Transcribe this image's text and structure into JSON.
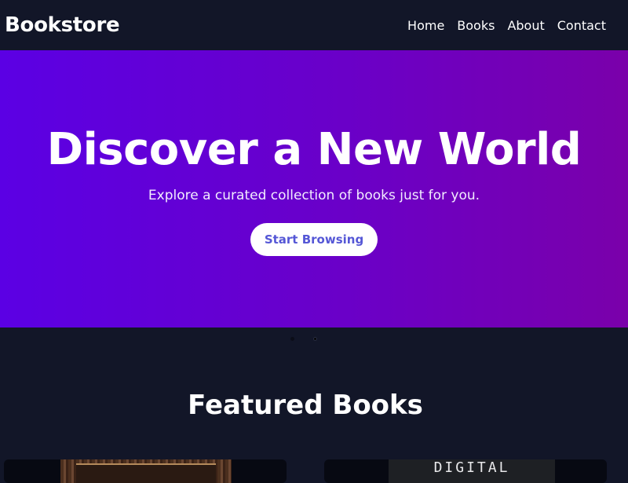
{
  "header": {
    "brand": "Bookstore",
    "nav": [
      "Home",
      "Books",
      "About",
      "Contact"
    ]
  },
  "hero": {
    "title": "Discover a New World",
    "subtitle": "Explore a curated collection of books just for you.",
    "cta_label": "Start Browsing"
  },
  "carousel": {
    "slide_count": 2,
    "active_index": 1
  },
  "featured": {
    "title": "Featured Books",
    "books": [
      {
        "cover_text": ""
      },
      {
        "cover_text": "DIGITAL"
      }
    ]
  },
  "colors": {
    "background": "#121628",
    "hero_gradient_start": "#5b00e4",
    "hero_gradient_end": "#7a00aa",
    "cta_text": "#5557d6"
  }
}
